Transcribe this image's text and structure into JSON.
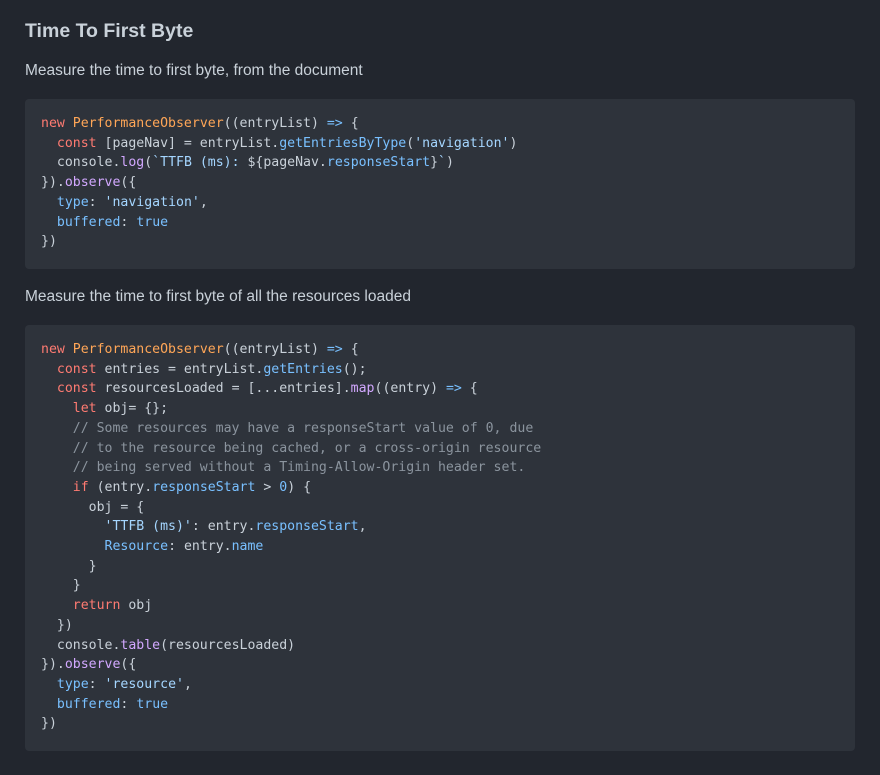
{
  "title": "Time To First Byte",
  "sections": [
    {
      "description": "Measure the time to first byte, from the document",
      "code_lines": [
        "new PerformanceObserver((entryList) => {",
        "  const [pageNav] = entryList.getEntriesByType('navigation')",
        "  console.log(`TTFB (ms): ${pageNav.responseStart}`)",
        "}).observe({",
        "  type: 'navigation',",
        "  buffered: true",
        "})"
      ]
    },
    {
      "description": "Measure the time to first byte of all the resources loaded",
      "code_lines": [
        "new PerformanceObserver((entryList) => {",
        "  const entries = entryList.getEntries();",
        "  const resourcesLoaded = [...entries].map((entry) => {",
        "    let obj= {};",
        "    // Some resources may have a responseStart value of 0, due",
        "    // to the resource being cached, or a cross-origin resource",
        "    // being served without a Timing-Allow-Origin header set.",
        "    if (entry.responseStart > 0) {",
        "      obj = {",
        "        'TTFB (ms)': entry.responseStart,",
        "        Resource: entry.name",
        "      }",
        "    }",
        "    return obj",
        "  })",
        "  console.table(resourcesLoaded)",
        "}).observe({",
        "  type: 'resource',",
        "  buffered: true",
        "})"
      ]
    }
  ],
  "colors": {
    "background": "#22262e",
    "code_background": "#2e333b",
    "keyword": "#ff7b72",
    "class": "#ffa657",
    "function": "#d2a8ff",
    "property": "#79c0ff",
    "string": "#a5d6ff",
    "comment": "#8b949e"
  }
}
